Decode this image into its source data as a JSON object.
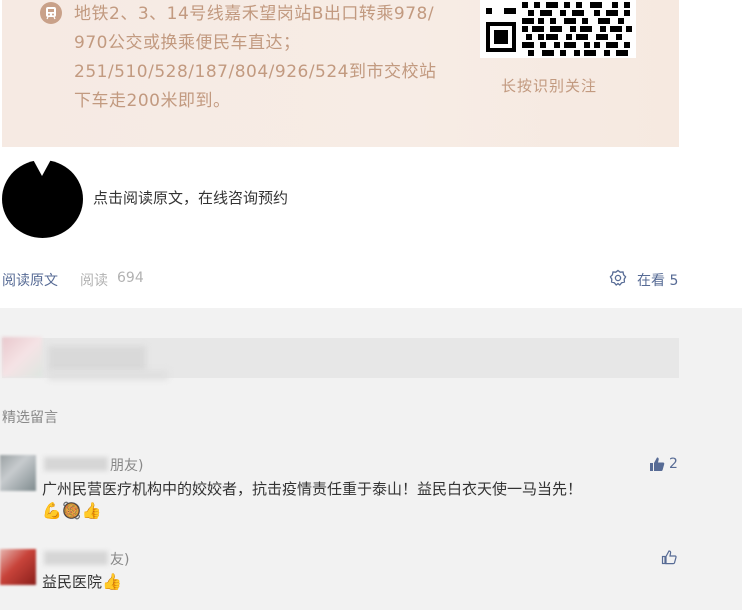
{
  "banner": {
    "lines": [
      "地铁2、3、14号线嘉禾望岗站B出口转乘978/",
      "970公交或换乘便民车直达；",
      "251/510/528/187/804/926/524到市交校站",
      "下车走200米即到。"
    ],
    "qr_hint": "长按识别关注"
  },
  "promo": {
    "text": "点击阅读原文，在线咨询预约"
  },
  "stats": {
    "read_original": "阅读原文",
    "read_label": "阅读",
    "read_count": "694",
    "watching": "在看 5"
  },
  "comments_section": {
    "title": "精选留言",
    "items": [
      {
        "name_suffix": "朋友)",
        "text": "广州民营医疗机构中的姣姣者，抗击疫情责任重于泰山！益民白衣天使一马当先！",
        "emoji": "💪🥘👍",
        "likes": "2"
      },
      {
        "name_suffix": "友)",
        "text": "益民医院",
        "emoji": "👍",
        "likes": ""
      }
    ]
  },
  "colors": {
    "link": "#576b95",
    "banner_text": "#c29a80",
    "comment_bg": "#f2f2f2"
  }
}
